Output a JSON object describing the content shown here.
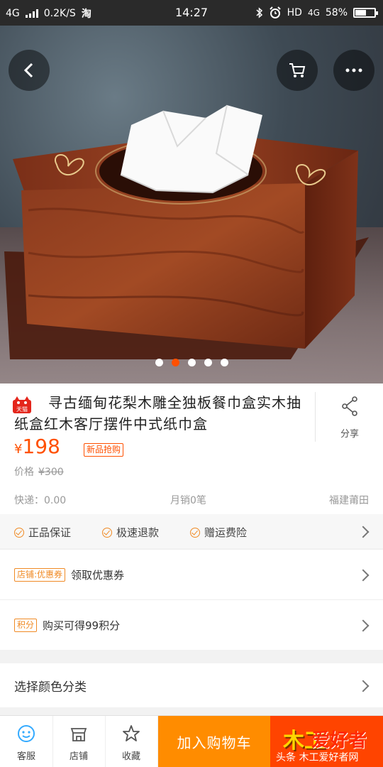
{
  "status_bar": {
    "network": "4G",
    "speed": "0.2K/S",
    "app_glyph": "淘",
    "time": "14:27",
    "hd_label": "HD",
    "net_right": "4G",
    "battery_percent": "58%",
    "battery_level": 0.58
  },
  "hero": {
    "image_count": 5,
    "active_index": 1
  },
  "product": {
    "badge": "天猫",
    "title": "寻古缅甸花梨木雕全独板餐巾盒实木抽纸盒红木客厅摆件中式纸巾盒",
    "share_label": "分享",
    "currency": "¥",
    "price": "198",
    "new_tag": "新品抢购",
    "orig_label": "价格",
    "orig_price": "¥300",
    "shipping": "快递：0.00",
    "monthly_sales": "月销0笔",
    "location": "福建莆田"
  },
  "guarantees": [
    {
      "label": "正品保证"
    },
    {
      "label": "极速退款"
    },
    {
      "label": "赠运费险"
    }
  ],
  "coupon_row": {
    "tag": "店铺:优惠券",
    "label": "领取优惠券"
  },
  "points_row": {
    "tag": "积分",
    "label": "购买可得99积分"
  },
  "spec_row": {
    "label": "选择颜色分类"
  },
  "bottom_bar": {
    "service_label": "客服",
    "shop_label": "店铺",
    "fav_label": "收藏",
    "cart_button": "加入购物车",
    "watermark_big1": "木工",
    "watermark_big2": "爱好者",
    "watermark_sub": "头条  木工爱好者网"
  }
}
